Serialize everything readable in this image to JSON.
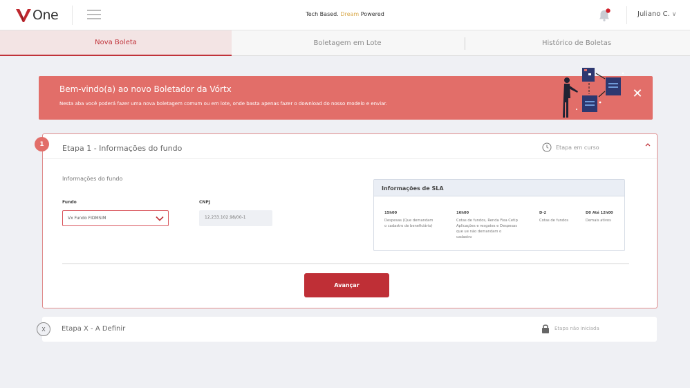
{
  "header": {
    "logo_letter": "V",
    "logo_text": "One",
    "slogan_prefix": "Tech Based.",
    "slogan_highlight": "Dream",
    "slogan_suffix": "Powered",
    "user_name": "Juliano C.",
    "user_chevron": "∨",
    "icons": [
      "menu-icon",
      "bell-icon",
      "chevron-down-icon"
    ]
  },
  "tabs": [
    {
      "label": "Nova Boleta",
      "active": true
    },
    {
      "label": "Boletagem em Lote",
      "active": false
    },
    {
      "label": "Histórico de Boletas",
      "active": false
    }
  ],
  "banner": {
    "title": "Bem-vindo(a) ao novo Boletador da Vórtx",
    "text": "Nesta aba você poderá fazer uma nova boletagem comum ou em lote, onde basta apenas fazer o download do nosso modelo e enviar.",
    "close": "✕",
    "color": "#e26e69"
  },
  "step1": {
    "number": "1",
    "title": "Etapa 1 - Informações do fundo",
    "status": "Etapa em curso",
    "section_label": "Informações  do fundo",
    "fundo_label": "Fundo",
    "fundo_value": "Vx Fundo FIDMSIM",
    "cnpj_label": "CNPJ",
    "cnpj_value": "12.233.102.98/00-1",
    "button": "Avançar",
    "accent": "#bf2f36"
  },
  "sla": {
    "title": "Informações de SLA",
    "columns": [
      {
        "time": "15h00",
        "desc": [
          "Despesas (Que demandam",
          "o cadastro de beneficiário)"
        ]
      },
      {
        "time": "16h00",
        "desc": [
          "Cotas de fundos, Renda Fixa Cetip",
          "Aplicações e resgates e Despesas",
          "que ue não demandam o",
          "cadastro"
        ]
      },
      {
        "time": "D-2",
        "desc": [
          "Cotas de fundos"
        ]
      },
      {
        "time": "D0 Até 12h00",
        "desc": [
          "Demais ativos"
        ]
      }
    ]
  },
  "stepx": {
    "number": "X",
    "title": "Etapa X - A Definir",
    "status": "Etapa não iniciada"
  }
}
